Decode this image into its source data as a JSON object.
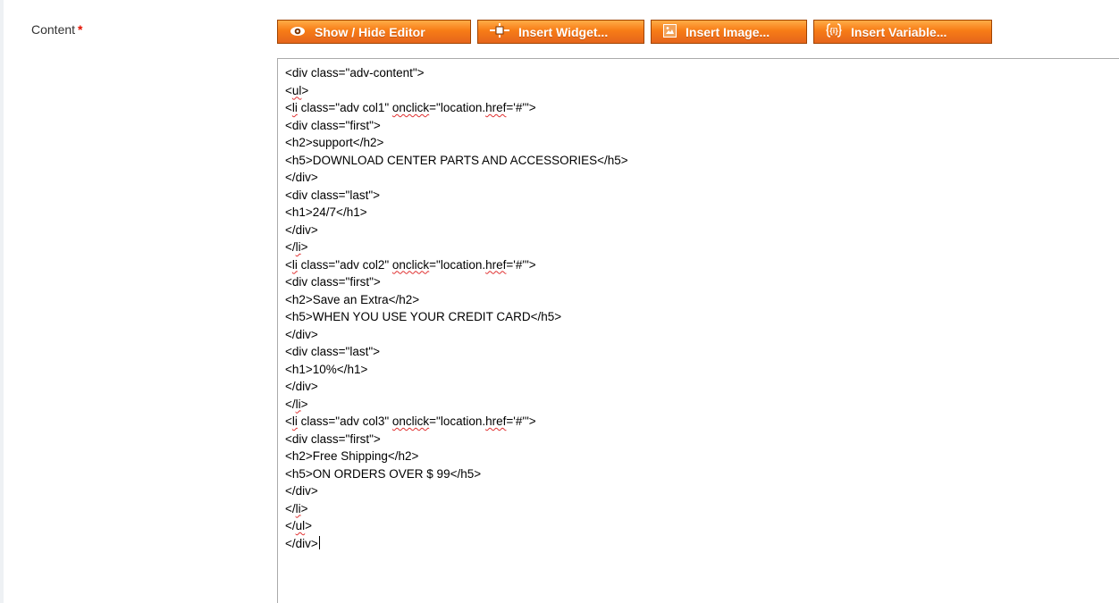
{
  "field": {
    "label": "Content",
    "required_marker": "*"
  },
  "toolbar": {
    "show_hide_editor": "Show / Hide Editor",
    "insert_widget": "Insert Widget...",
    "insert_image": "Insert Image...",
    "insert_variable": "Insert Variable..."
  },
  "colors": {
    "button_orange": "#f77c16",
    "button_border": "#a04300",
    "required_red": "#e41101",
    "spellcheck_red": "#e03030"
  },
  "icons": [
    "eye-icon",
    "widget-icon",
    "image-icon",
    "variable-icon"
  ],
  "editor": {
    "lines": [
      [
        {
          "t": "<div class=\"adv-content\">"
        }
      ],
      [
        {
          "t": "<"
        },
        {
          "t": "ul",
          "sp": true
        },
        {
          "t": ">"
        }
      ],
      [
        {
          "t": "<"
        },
        {
          "t": "li",
          "sp": true
        },
        {
          "t": " class=\"adv col1\" "
        },
        {
          "t": "onclick",
          "sp": true
        },
        {
          "t": "=\"location."
        },
        {
          "t": "href",
          "sp": true
        },
        {
          "t": "='#'\">"
        }
      ],
      [
        {
          "t": "<div class=\"first\">"
        }
      ],
      [
        {
          "t": "<h2>support</h2>"
        }
      ],
      [
        {
          "t": "<h5>DOWNLOAD CENTER PARTS AND ACCESSORIES</h5>"
        }
      ],
      [
        {
          "t": "</div>"
        }
      ],
      [
        {
          "t": "<div class=\"last\">"
        }
      ],
      [
        {
          "t": "<h1>24/7</h1>"
        }
      ],
      [
        {
          "t": "</div>"
        }
      ],
      [
        {
          "t": "</"
        },
        {
          "t": "li",
          "sp": true
        },
        {
          "t": ">"
        }
      ],
      [
        {
          "t": "<"
        },
        {
          "t": "li",
          "sp": true
        },
        {
          "t": " class=\"adv col2\" "
        },
        {
          "t": "onclick",
          "sp": true
        },
        {
          "t": "=\"location."
        },
        {
          "t": "href",
          "sp": true
        },
        {
          "t": "='#'\">"
        }
      ],
      [
        {
          "t": "<div class=\"first\">"
        }
      ],
      [
        {
          "t": "<h2>Save an Extra</h2>"
        }
      ],
      [
        {
          "t": "<h5>WHEN YOU USE YOUR CREDIT CARD</h5>"
        }
      ],
      [
        {
          "t": "</div>"
        }
      ],
      [
        {
          "t": "<div class=\"last\">"
        }
      ],
      [
        {
          "t": "<h1>10%</h1>"
        }
      ],
      [
        {
          "t": "</div>"
        }
      ],
      [
        {
          "t": "</"
        },
        {
          "t": "li",
          "sp": true
        },
        {
          "t": ">"
        }
      ],
      [
        {
          "t": "<"
        },
        {
          "t": "li",
          "sp": true
        },
        {
          "t": " class=\"adv col3\" "
        },
        {
          "t": "onclick",
          "sp": true
        },
        {
          "t": "=\"location."
        },
        {
          "t": "href",
          "sp": true
        },
        {
          "t": "='#'\">"
        }
      ],
      [
        {
          "t": "<div class=\"first\">"
        }
      ],
      [
        {
          "t": "<h2>Free Shipping</h2>"
        }
      ],
      [
        {
          "t": "<h5>ON ORDERS OVER $ 99</h5>"
        }
      ],
      [
        {
          "t": "</div>"
        }
      ],
      [
        {
          "t": "</"
        },
        {
          "t": "li",
          "sp": true
        },
        {
          "t": ">"
        }
      ],
      [
        {
          "t": "</"
        },
        {
          "t": "ul",
          "sp": true
        },
        {
          "t": ">"
        }
      ],
      [
        {
          "t": "</div>"
        }
      ]
    ]
  }
}
